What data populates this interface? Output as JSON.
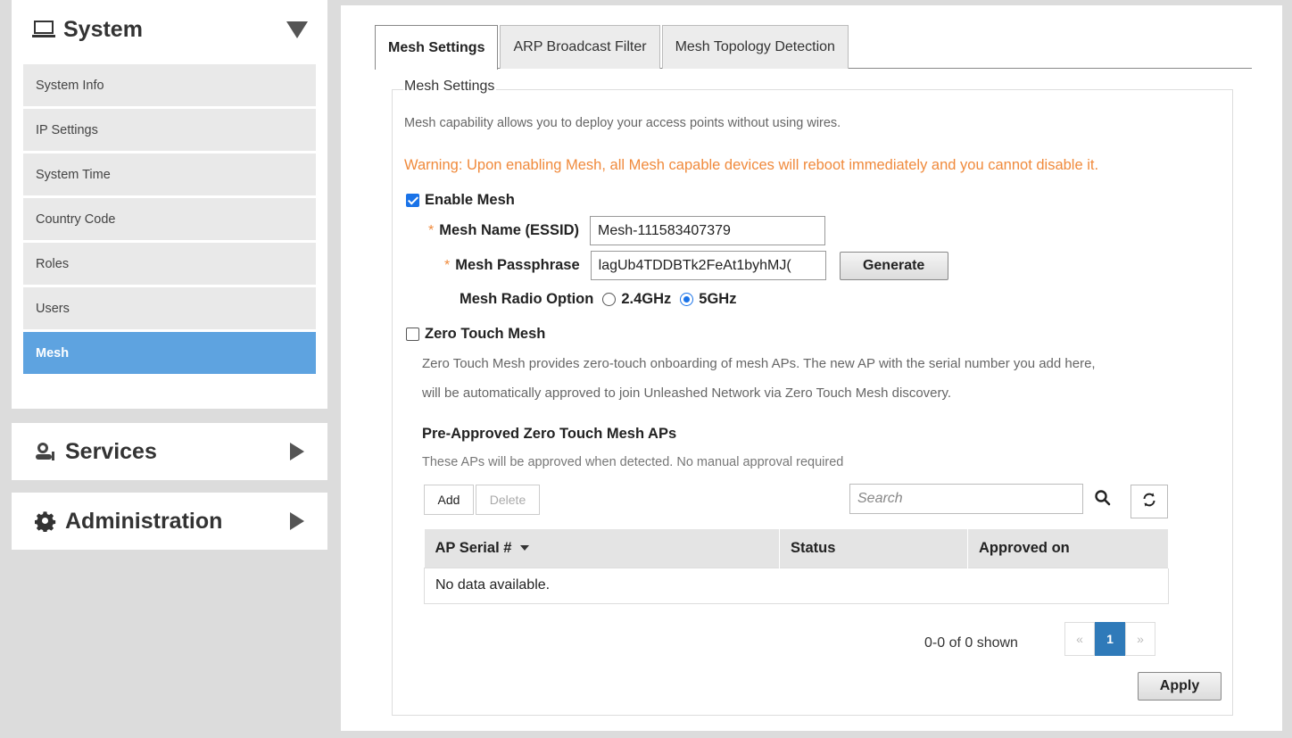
{
  "sidebar": {
    "system": {
      "title": "System",
      "items": [
        "System Info",
        "IP Settings",
        "System Time",
        "Country Code",
        "Roles",
        "Users",
        "Mesh"
      ],
      "active": "Mesh"
    },
    "services": {
      "title": "Services"
    },
    "administration": {
      "title": "Administration"
    }
  },
  "tabs": [
    "Mesh Settings",
    "ARP Broadcast Filter",
    "Mesh Topology Detection"
  ],
  "mesh": {
    "legend": "Mesh Settings",
    "description": "Mesh capability allows you to deploy your access points without using wires.",
    "warning": "Warning: Upon enabling Mesh, all Mesh capable devices will reboot immediately and you cannot disable it.",
    "enable_label": "Enable Mesh",
    "enable_checked": true,
    "name_label": "Mesh Name (ESSID)",
    "name_value": "Mesh-111583407379",
    "passphrase_label": "Mesh Passphrase",
    "passphrase_value": "lagUb4TDDBTk2FeAt1byhMJ(",
    "generate_label": "Generate",
    "radio_label": "Mesh Radio Option",
    "radio_options": [
      "2.4GHz",
      "5GHz"
    ],
    "radio_selected": "5GHz",
    "required_mark": "*"
  },
  "zero_touch": {
    "label": "Zero Touch Mesh",
    "checked": false,
    "desc_line1": "Zero Touch Mesh provides zero-touch onboarding of mesh APs. The new AP with the serial number you add here,",
    "desc_line2": "will be automatically approved to join Unleashed Network via Zero Touch Mesh discovery.",
    "preapproved_title": "Pre-Approved Zero Touch Mesh APs",
    "preapproved_desc": "These APs will be approved when detected. No manual approval required",
    "add_label": "Add",
    "delete_label": "Delete",
    "search_placeholder": "Search",
    "columns": [
      "AP Serial #",
      "Status",
      "Approved on"
    ],
    "empty_text": "No data available.",
    "pager_text": "0-0 of 0 shown",
    "pager": {
      "prev": "«",
      "current": "1",
      "next": "»"
    }
  },
  "apply_label": "Apply",
  "colors": {
    "accent": "#5ea3e0",
    "warning": "#f08a3c",
    "pager_active": "#2f7ab9",
    "checkbox": "#1a73e8"
  }
}
